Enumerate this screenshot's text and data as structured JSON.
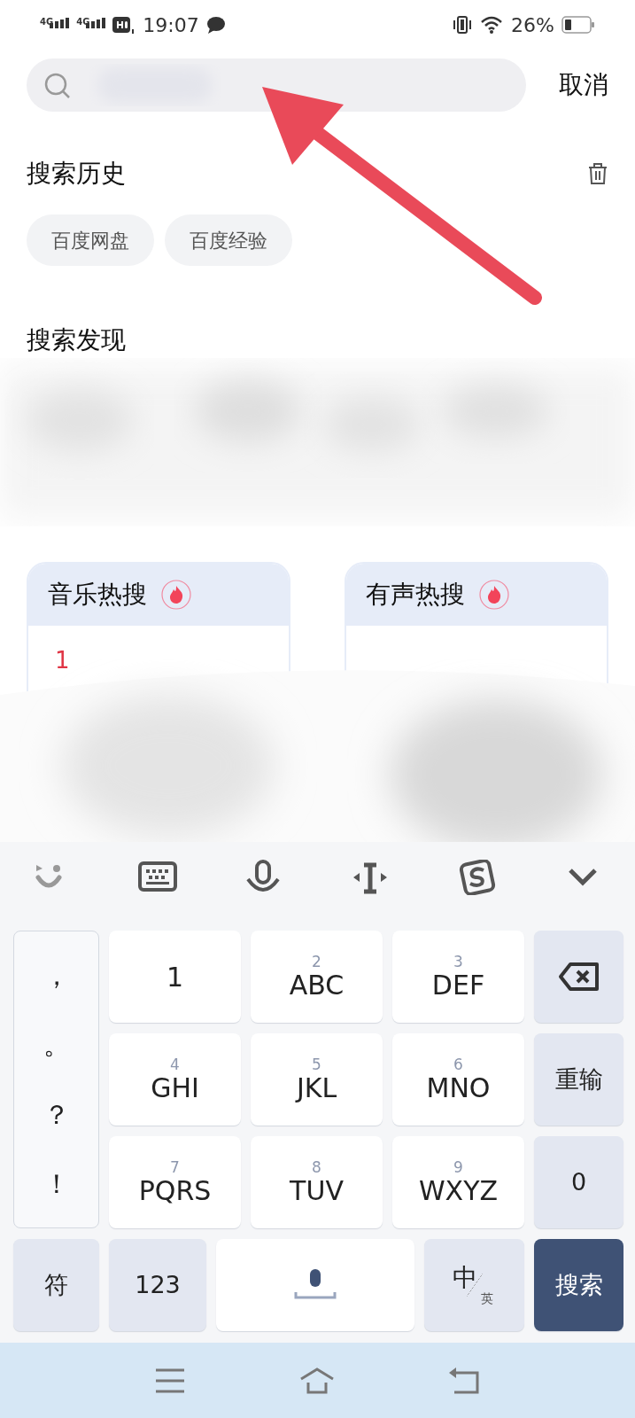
{
  "status_bar": {
    "networks": [
      "4G",
      "4G"
    ],
    "time": "19:07",
    "battery": "26%"
  },
  "search": {
    "cancel": "取消"
  },
  "history": {
    "title": "搜索历史",
    "items": [
      "百度网盘",
      "百度经验"
    ]
  },
  "discover": {
    "title": "搜索发现"
  },
  "hot_lists": [
    {
      "title": "音乐热搜",
      "items": [
        {
          "rank": "1"
        }
      ]
    },
    {
      "title": "有声热搜"
    }
  ],
  "keyboard": {
    "tools": [
      {
        "kind": "emoji"
      },
      {
        "kind": "keyboard"
      },
      {
        "kind": "mic"
      },
      {
        "kind": "cursor"
      },
      {
        "kind": "sogou"
      },
      {
        "kind": "collapse"
      }
    ],
    "punctuation": [
      "，",
      "。",
      "？",
      "！"
    ],
    "keys": [
      {
        "main": "1"
      },
      {
        "sub": "2",
        "main": "ABC"
      },
      {
        "sub": "3",
        "main": "DEF"
      },
      {
        "kind": "backspace"
      },
      {
        "sub": "4",
        "main": "GHI"
      },
      {
        "sub": "5",
        "main": "JKL"
      },
      {
        "sub": "6",
        "main": "MNO"
      },
      {
        "kind": "function",
        "main": "重输"
      },
      {
        "sub": "7",
        "main": "PQRS"
      },
      {
        "sub": "8",
        "main": "TUV"
      },
      {
        "sub": "9",
        "main": "WXYZ"
      },
      {
        "kind": "function",
        "main": "0"
      }
    ],
    "bottom": [
      {
        "kind": "function",
        "main": "符"
      },
      {
        "kind": "function",
        "main": "123"
      },
      {
        "kind": "space"
      },
      {
        "kind": "lang",
        "main": "中",
        "sub": "英"
      },
      {
        "kind": "primary",
        "main": "搜索"
      }
    ]
  },
  "nav_bar": [
    {
      "kind": "menu"
    },
    {
      "kind": "home"
    },
    {
      "kind": "back"
    }
  ]
}
